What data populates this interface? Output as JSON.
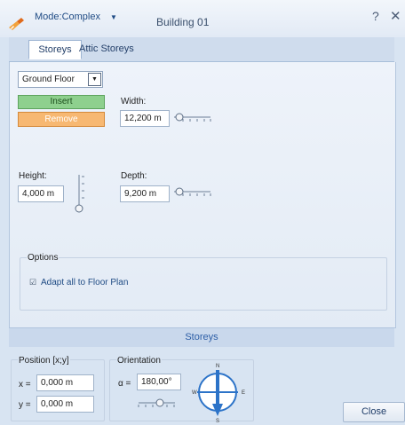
{
  "window": {
    "mode_label": "Mode:Complex",
    "title": "Building 01",
    "help_glyph": "?",
    "close_glyph": "✕",
    "app_icon": "building-pencil-icon"
  },
  "tabs": [
    {
      "label": "Storeys",
      "active": true
    },
    {
      "label": "Attic Storeys",
      "active": false
    }
  ],
  "storey_select": {
    "value": "Ground Floor",
    "arrow_glyph": "▼"
  },
  "buttons": {
    "insert": "Insert",
    "remove": "Remove",
    "close": "Close"
  },
  "width": {
    "label": "Width:",
    "value": "12,200 m"
  },
  "depth": {
    "label": "Depth:",
    "value": "9,200 m"
  },
  "height": {
    "label": "Height:",
    "value": "4,000 m"
  },
  "options": {
    "title": "Options",
    "adapt_checkbox": {
      "label": "Adapt all to Floor Plan",
      "checked": true,
      "glyph": "☑"
    }
  },
  "footer_label": "Storeys",
  "position": {
    "title": "Position [x;y]",
    "x_label": "x =",
    "x_value": "0,000 m",
    "y_label": "y =",
    "y_value": "0,000 m"
  },
  "orientation": {
    "title": "Orientation",
    "alpha_label": "α =",
    "angle_value": "180,00°",
    "compass": {
      "n": "N",
      "s": "S",
      "e": "E",
      "w": "W",
      "pointing": "S"
    }
  },
  "colors": {
    "accent": "#2d5ea6",
    "insert_bg": "#8ed08e",
    "remove_bg": "#f7b872",
    "compass_arrow": "#2c73c8"
  }
}
